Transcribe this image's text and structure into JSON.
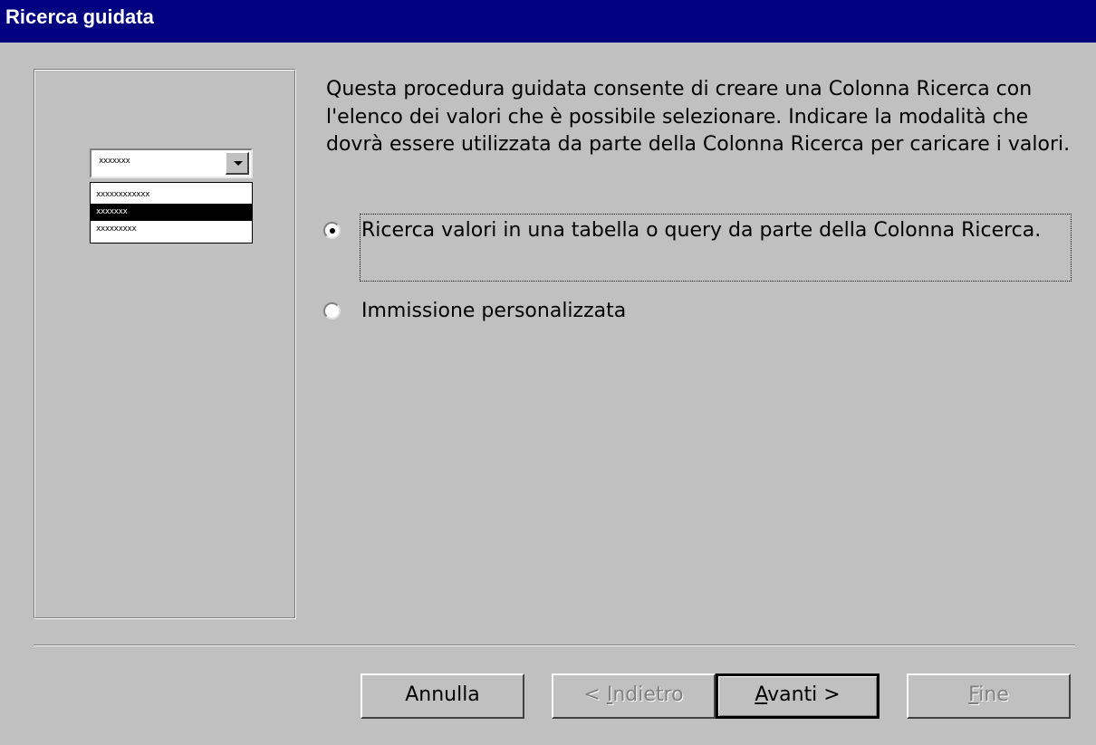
{
  "window": {
    "title": "Ricerca guidata"
  },
  "illustration": {
    "combo_value": "xxxxxxx",
    "list_items": [
      "xxxxxxxxxxxx",
      "xxxxxxx",
      "xxxxxxxxx"
    ],
    "selected_index": 1
  },
  "description": "Questa procedura guidata consente di creare una Colonna Ricerca con l'elenco dei valori che è possibile selezionare. Indicare la modalità che dovrà essere utilizzata da parte della Colonna Ricerca per caricare i valori.",
  "options": [
    {
      "label": "Ricerca valori in una tabella o query da parte della Colonna Ricerca.",
      "checked": true
    },
    {
      "label": "Immissione personalizzata",
      "checked": false
    }
  ],
  "buttons": {
    "cancel": "Annulla",
    "back_prefix": "< ",
    "back_accel": "I",
    "back_rest": "ndietro",
    "next_accel": "A",
    "next_rest": "vanti >",
    "finish_accel": "F",
    "finish_rest": "ine"
  }
}
